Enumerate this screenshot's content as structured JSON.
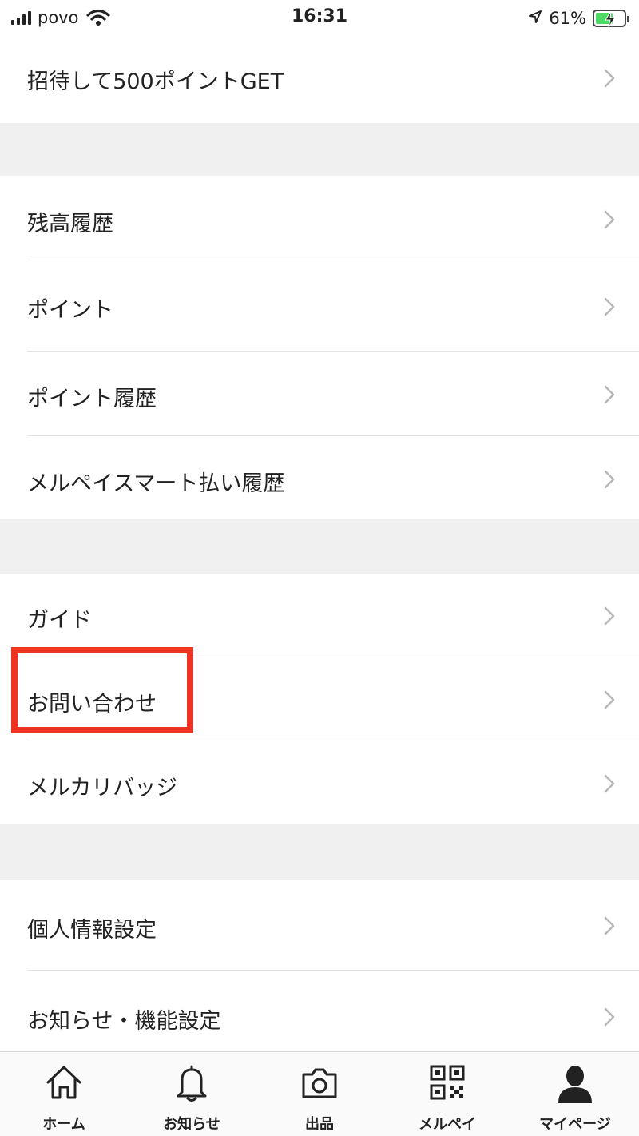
{
  "status_bar": {
    "carrier": "povo",
    "time": "16:31",
    "battery_percent": "61%",
    "battery_level": 0.61,
    "battery_color": "#4cd964"
  },
  "menu": {
    "invite": "招待して500ポイントGET",
    "balance_history": "残高履歴",
    "points": "ポイント",
    "point_history": "ポイント履歴",
    "smart_pay_history": "メルペイスマート払い履歴",
    "guide": "ガイド",
    "contact": "お問い合わせ",
    "badge": "メルカリバッジ",
    "privacy_settings": "個人情報設定",
    "notification_settings": "お知らせ・機能設定"
  },
  "highlight_color": "#ee3322",
  "tabs": [
    {
      "label": "ホーム",
      "icon": "home-icon"
    },
    {
      "label": "お知らせ",
      "icon": "bell-icon"
    },
    {
      "label": "出品",
      "icon": "camera-icon"
    },
    {
      "label": "メルペイ",
      "icon": "qr-code-icon"
    },
    {
      "label": "マイページ",
      "icon": "person-icon"
    }
  ]
}
